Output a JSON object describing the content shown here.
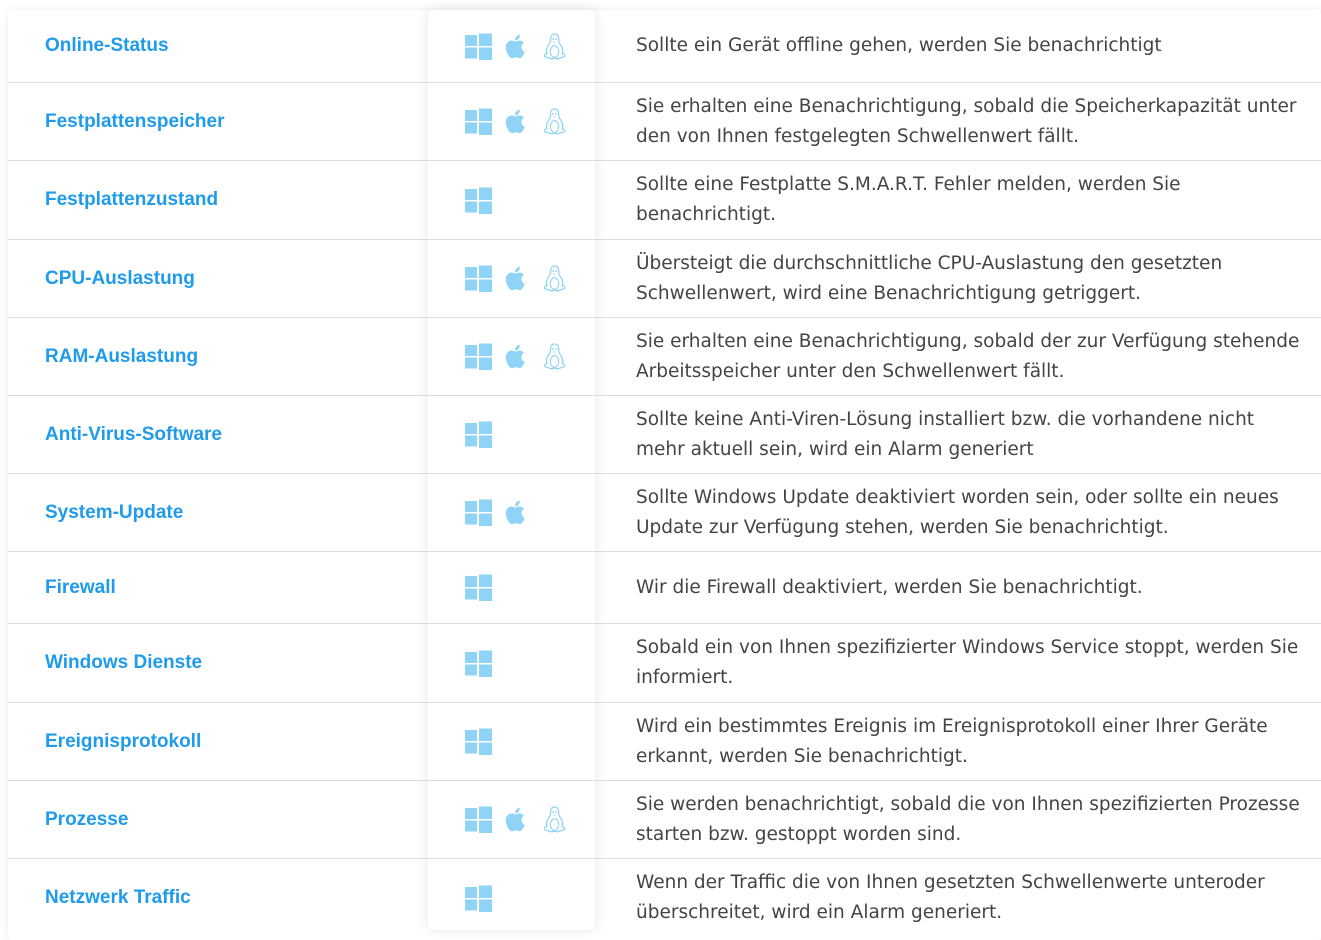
{
  "colors": {
    "accent": "#1e9bea",
    "icon": "#8fd3f7",
    "text": "#444444",
    "divider": "#dcdcdc"
  },
  "rows": [
    {
      "feature": "Online-Status",
      "os": [
        "windows-icon",
        "apple-icon",
        "linux-icon"
      ],
      "description": "Sollte ein Gerät offline gehen, werden Sie benachrichtigt"
    },
    {
      "feature": "Festplattenspeicher",
      "os": [
        "windows-icon",
        "apple-icon",
        "linux-icon"
      ],
      "description": "Sie erhalten eine Benachrichtigung, sobald die Speicherkapazität unter den von Ihnen festgelegten Schwellenwert fällt."
    },
    {
      "feature": "Festplattenzustand",
      "os": [
        "windows-icon"
      ],
      "description": "Sollte eine Festplatte S.M.A.R.T. Fehler melden, werden Sie benachrichtigt."
    },
    {
      "feature": "CPU-Auslastung",
      "os": [
        "windows-icon",
        "apple-icon",
        "linux-icon"
      ],
      "description": "Übersteigt die durchschnittliche CPU-Auslastung den gesetzten Schwellenwert, wird eine Benachrichtigung getriggert."
    },
    {
      "feature": "RAM-Auslastung",
      "os": [
        "windows-icon",
        "apple-icon",
        "linux-icon"
      ],
      "description": "Sie erhalten eine Benachrichtigung, sobald der zur Verfügung stehende Arbeitsspeicher unter den Schwellenwert fällt."
    },
    {
      "feature": "Anti-Virus-Software",
      "os": [
        "windows-icon"
      ],
      "description": "Sollte keine Anti-Viren-Lösung installiert bzw. die vorhandene nicht mehr aktuell sein, wird ein Alarm generiert"
    },
    {
      "feature": "System-Update",
      "os": [
        "windows-icon",
        "apple-icon"
      ],
      "description": "Sollte Windows Update deaktiviert worden sein, oder sollte ein neues Update zur Verfügung stehen, werden Sie benachrichtigt."
    },
    {
      "feature": "Firewall",
      "os": [
        "windows-icon"
      ],
      "description": "Wir die Firewall deaktiviert, werden Sie benachrichtigt."
    },
    {
      "feature": "Windows Dienste",
      "os": [
        "windows-icon"
      ],
      "description": "Sobald ein von Ihnen spezifizierter Windows Service stoppt, werden Sie informiert."
    },
    {
      "feature": "Ereignisprotokoll",
      "os": [
        "windows-icon"
      ],
      "description": "Wird ein bestimmtes Ereignis im Ereignisprotokoll einer Ihrer Geräte erkannt, werden Sie benachrichtigt."
    },
    {
      "feature": "Prozesse",
      "os": [
        "windows-icon",
        "apple-icon",
        "linux-icon"
      ],
      "description": "Sie werden benachrichtigt, sobald die von Ihnen spezifizierten Prozesse starten bzw. gestoppt worden sind."
    },
    {
      "feature": "Netzwerk Traffic",
      "os": [
        "windows-icon"
      ],
      "description": "Wenn der Traffic die von Ihnen gesetzten Schwellenwerte unteroder überschreitet, wird ein Alarm generiert."
    }
  ]
}
